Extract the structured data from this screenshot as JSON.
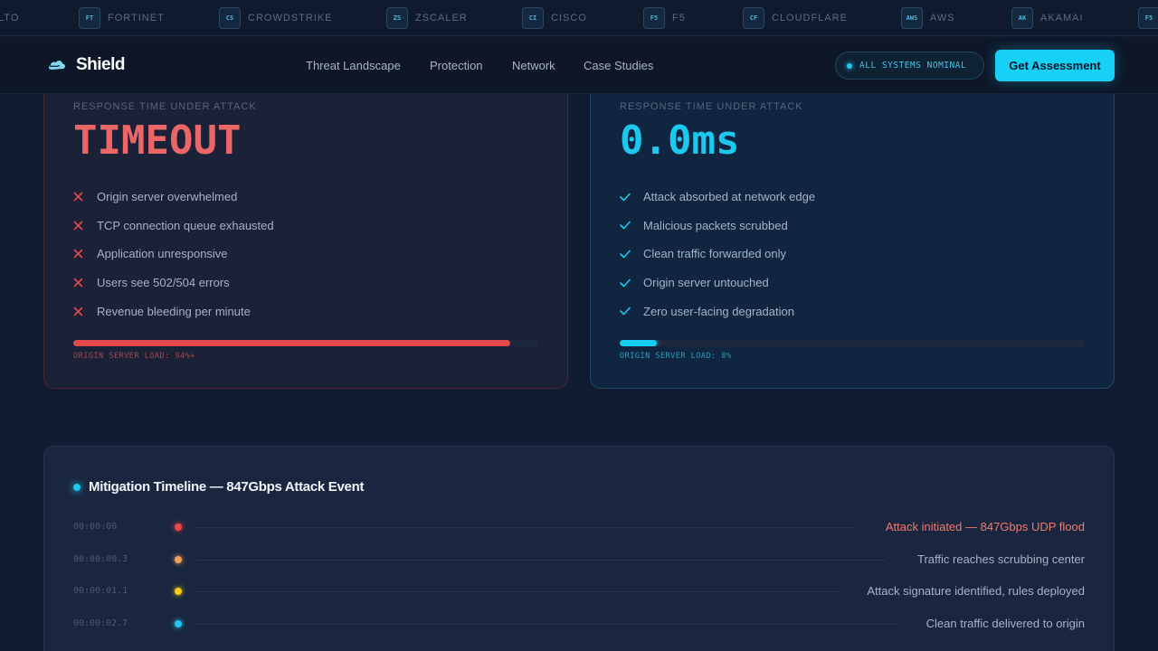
{
  "partners": [
    {
      "abbr": "",
      "name": "LTO"
    },
    {
      "abbr": "FT",
      "name": "FORTINET"
    },
    {
      "abbr": "CS",
      "name": "CROWDSTRIKE"
    },
    {
      "abbr": "ZS",
      "name": "ZSCALER"
    },
    {
      "abbr": "CI",
      "name": "CISCO"
    },
    {
      "abbr": "F5",
      "name": "F5"
    },
    {
      "abbr": "CF",
      "name": "CLOUDFLARE"
    },
    {
      "abbr": "AWS",
      "name": "AWS"
    },
    {
      "abbr": "AK",
      "name": "AKAMAI"
    },
    {
      "abbr": "F5",
      "name": ""
    }
  ],
  "nav": {
    "brand": "Shield",
    "links": [
      "Threat Landscape",
      "Protection",
      "Network",
      "Case Studies"
    ],
    "status": "ALL SYSTEMS NOMINAL",
    "cta": "Get Assessment"
  },
  "compare": {
    "unprotected": {
      "label": "RESPONSE TIME UNDER ATTACK",
      "value": "TIMEOUT",
      "items": [
        "Origin server overwhelmed",
        "TCP connection queue exhausted",
        "Application unresponsive",
        "Users see 502/504 errors",
        "Revenue bleeding per minute"
      ],
      "load_fraction": 0.94,
      "load_label": "ORIGIN SERVER LOAD: 94%+"
    },
    "protected": {
      "label": "RESPONSE TIME UNDER ATTACK",
      "value": "0.0ms",
      "items": [
        "Attack absorbed at network edge",
        "Malicious packets scrubbed",
        "Clean traffic forwarded only",
        "Origin server untouched",
        "Zero user-facing degradation"
      ],
      "load_fraction": 0.08,
      "load_label": "ORIGIN SERVER LOAD: 8%"
    }
  },
  "timeline": {
    "title": "Mitigation Timeline — 847Gbps Attack Event",
    "events": [
      {
        "time": "00:00:00",
        "text": "Attack initiated — 847Gbps UDP flood",
        "color": "#ef4444",
        "text_color": "#f07a6e"
      },
      {
        "time": "00:00:00.3",
        "text": "Traffic reaches scrubbing center",
        "color": "#f59e5b",
        "text_color": "#a6b2c5"
      },
      {
        "time": "00:00:01.1",
        "text": "Attack signature identified, rules deployed",
        "color": "#facc15",
        "text_color": "#a6b2c5"
      },
      {
        "time": "00:00:02.7",
        "text": "Clean traffic delivered to origin",
        "color": "#22c8f0",
        "text_color": "#a6b2c5"
      }
    ]
  }
}
